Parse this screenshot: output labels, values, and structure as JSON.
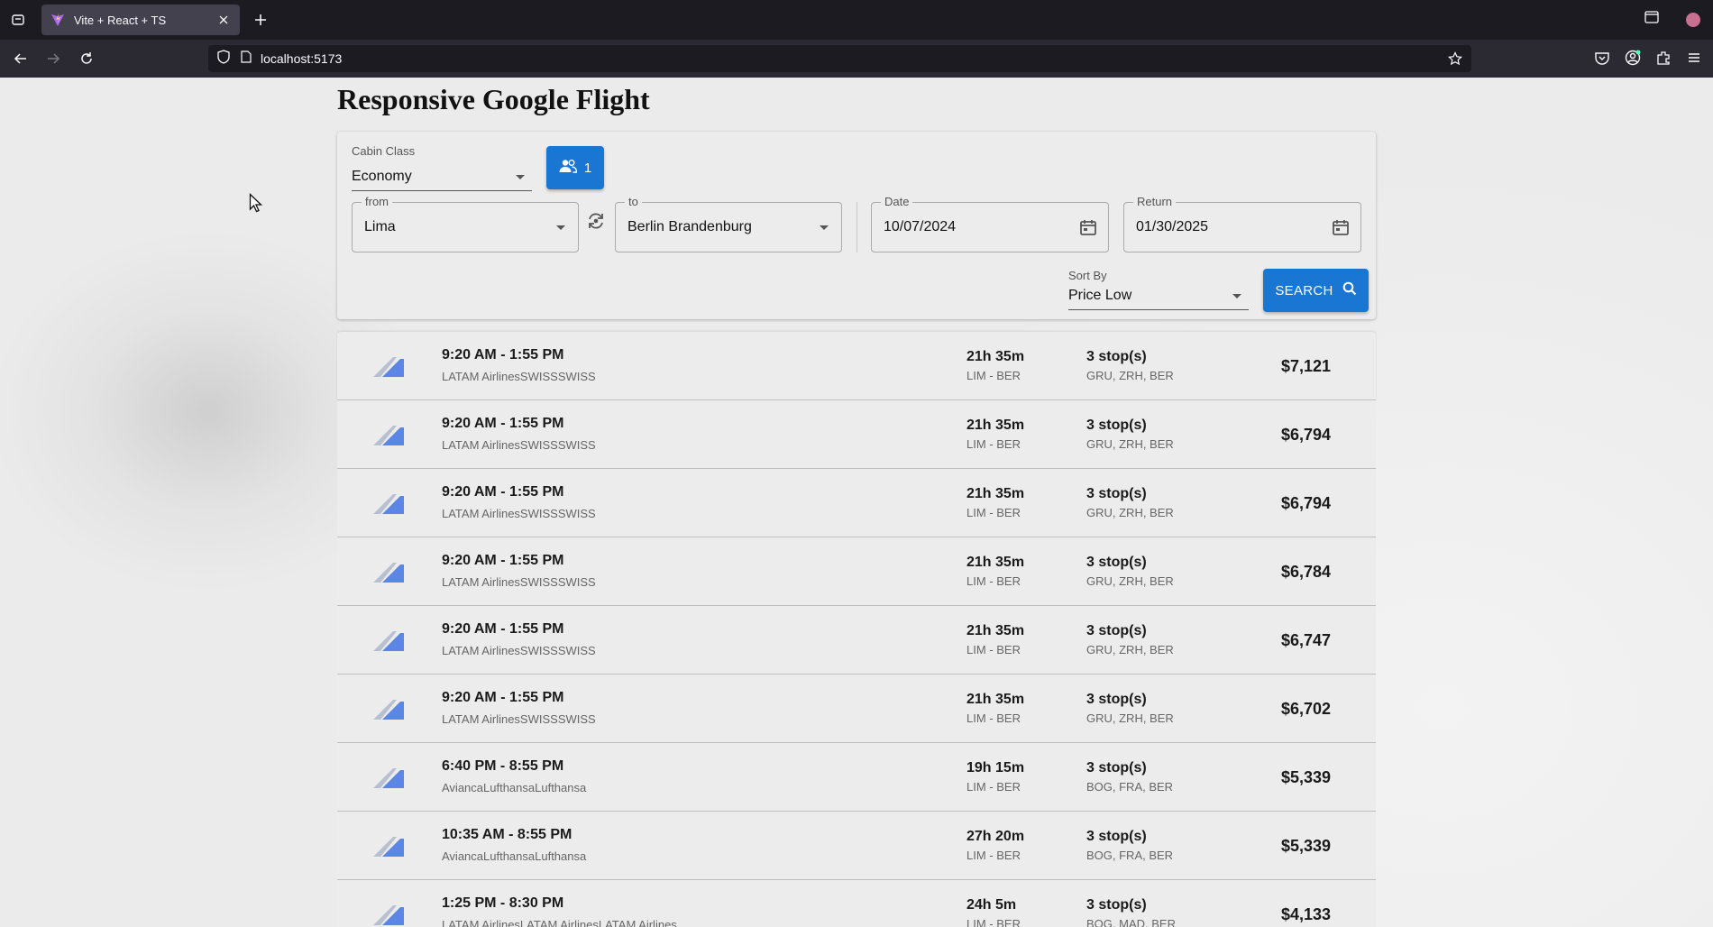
{
  "browser": {
    "tab_title": "Vite + React + TS",
    "url": "localhost:5173"
  },
  "page": {
    "title": "Responsive Google Flight"
  },
  "search_form": {
    "cabin_class": {
      "label": "Cabin Class",
      "value": "Economy"
    },
    "passengers": {
      "count": "1"
    },
    "from": {
      "label": "from",
      "value": "Lima"
    },
    "to": {
      "label": "to",
      "value": "Berlin Brandenburg"
    },
    "date": {
      "label": "Date",
      "value": "10/07/2024"
    },
    "return": {
      "label": "Return",
      "value": "01/30/2025"
    },
    "sort_by": {
      "label": "Sort By",
      "value": "Price Low"
    },
    "search_label": "SEARCH"
  },
  "results": [
    {
      "time": "9:20 AM - 1:55 PM",
      "airlines": "LATAM AirlinesSWISSSWISS",
      "duration": "21h 35m",
      "route": "LIM - BER",
      "stops": "3 stop(s)",
      "stops_detail": "GRU, ZRH, BER",
      "price": "$7,121"
    },
    {
      "time": "9:20 AM - 1:55 PM",
      "airlines": "LATAM AirlinesSWISSSWISS",
      "duration": "21h 35m",
      "route": "LIM - BER",
      "stops": "3 stop(s)",
      "stops_detail": "GRU, ZRH, BER",
      "price": "$6,794"
    },
    {
      "time": "9:20 AM - 1:55 PM",
      "airlines": "LATAM AirlinesSWISSSWISS",
      "duration": "21h 35m",
      "route": "LIM - BER",
      "stops": "3 stop(s)",
      "stops_detail": "GRU, ZRH, BER",
      "price": "$6,794"
    },
    {
      "time": "9:20 AM - 1:55 PM",
      "airlines": "LATAM AirlinesSWISSSWISS",
      "duration": "21h 35m",
      "route": "LIM - BER",
      "stops": "3 stop(s)",
      "stops_detail": "GRU, ZRH, BER",
      "price": "$6,784"
    },
    {
      "time": "9:20 AM - 1:55 PM",
      "airlines": "LATAM AirlinesSWISSSWISS",
      "duration": "21h 35m",
      "route": "LIM - BER",
      "stops": "3 stop(s)",
      "stops_detail": "GRU, ZRH, BER",
      "price": "$6,747"
    },
    {
      "time": "9:20 AM - 1:55 PM",
      "airlines": "LATAM AirlinesSWISSSWISS",
      "duration": "21h 35m",
      "route": "LIM - BER",
      "stops": "3 stop(s)",
      "stops_detail": "GRU, ZRH, BER",
      "price": "$6,702"
    },
    {
      "time": "6:40 PM - 8:55 PM",
      "airlines": "AviancaLufthansaLufthansa",
      "duration": "19h 15m",
      "route": "LIM - BER",
      "stops": "3 stop(s)",
      "stops_detail": "BOG, FRA, BER",
      "price": "$5,339"
    },
    {
      "time": "10:35 AM - 8:55 PM",
      "airlines": "AviancaLufthansaLufthansa",
      "duration": "27h 20m",
      "route": "LIM - BER",
      "stops": "3 stop(s)",
      "stops_detail": "BOG, FRA, BER",
      "price": "$5,339"
    },
    {
      "time": "1:25 PM - 8:30 PM",
      "airlines": "LATAM AirlinesLATAM AirlinesLATAM Airlines",
      "duration": "24h 5m",
      "route": "LIM - BER",
      "stops": "3 stop(s)",
      "stops_detail": "BOG, MAD, BER",
      "price": "$4,133"
    }
  ],
  "colors": {
    "accent": "#1976d2",
    "chrome_dark": "#1c1b22",
    "chrome_toolbar": "#2b2a33"
  },
  "icons": [
    "tab-list-icon",
    "vite-favicon-icon",
    "close-icon",
    "plus-icon",
    "window-icon",
    "back-icon",
    "forward-icon",
    "reload-icon",
    "shield-icon",
    "page-icon",
    "star-icon",
    "pocket-icon",
    "account-icon",
    "extensions-icon",
    "menu-icon",
    "people-icon",
    "swap-icon",
    "calendar-icon",
    "search-icon",
    "airline-logo-icon"
  ]
}
